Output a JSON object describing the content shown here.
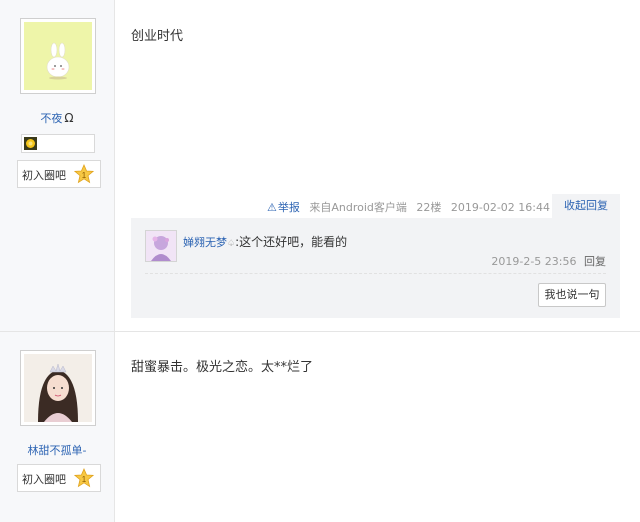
{
  "posts": [
    {
      "username": "不夜",
      "username_suffix": "Ω",
      "level_label": "初入圈吧",
      "level_number": 1,
      "content": "创业时代",
      "meta": {
        "report_label": "举报",
        "client_text": "来自Android客户端",
        "floor": "22楼",
        "time": "2019-02-02 16:44",
        "fold_reply_label": "收起回复"
      },
      "replies": [
        {
          "username": "婵翙无梦",
          "username_suffix": "♤",
          "separator": ":",
          "text": "这个还好吧，能看的",
          "time": "2019-2-5 23:56",
          "reply_label": "回复"
        }
      ],
      "say_button_label": "我也说一句"
    },
    {
      "username": "林甜不孤单-",
      "level_label": "初入圈吧",
      "level_number": 1,
      "content": "甜蜜暴击。极光之恋。太**烂了"
    }
  ],
  "colors": {
    "link": "#2d64b3",
    "muted": "#999999",
    "sidebar_bg": "#f7f8fa",
    "reply_bg": "#f2f3f5"
  }
}
